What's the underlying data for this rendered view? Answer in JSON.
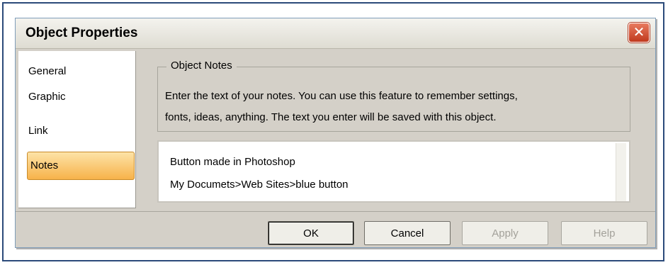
{
  "dialog": {
    "title": "Object Properties",
    "close_glyph": "✕"
  },
  "sidebar": {
    "items": [
      {
        "label": "General"
      },
      {
        "label": "Graphic"
      },
      {
        "label": "Link"
      },
      {
        "label": "Notes",
        "selected": true
      }
    ]
  },
  "notes_group": {
    "legend": "Object Notes",
    "description_lines": [
      "Enter the text of your notes. You can use this feature to remember settings,",
      "fonts, ideas, anything. The text you enter will be saved with this object."
    ]
  },
  "notes_field": {
    "lines": [
      "Button made in Photoshop",
      "My Documets>Web Sites>blue button"
    ]
  },
  "buttons": {
    "ok": "OK",
    "cancel": "Cancel",
    "apply": "Apply",
    "help": "Help"
  },
  "icons": {
    "close": "close-icon"
  },
  "colors": {
    "selected_tab": "#f7b24a",
    "close_button": "#c0391d"
  }
}
